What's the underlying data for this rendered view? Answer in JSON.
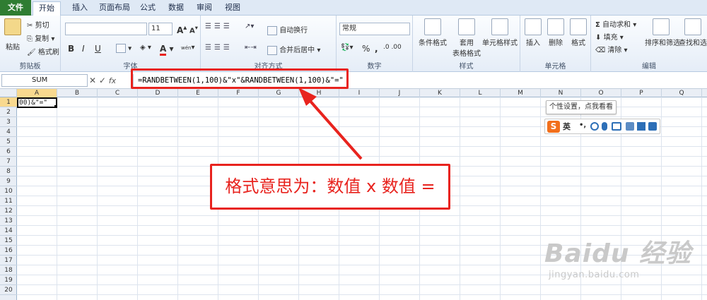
{
  "tabs": [
    {
      "label": "文件"
    },
    {
      "label": "开始"
    },
    {
      "label": "插入"
    },
    {
      "label": "页面布局"
    },
    {
      "label": "公式"
    },
    {
      "label": "数据"
    },
    {
      "label": "审阅"
    },
    {
      "label": "视图"
    }
  ],
  "ribbon": {
    "clipboard": {
      "paste": "粘贴",
      "cut": "剪切",
      "copy": "复制",
      "format_painter": "格式刷",
      "group": "剪贴板"
    },
    "font": {
      "size": "11",
      "bold": "B",
      "italic": "I",
      "underline": "U",
      "grow": "A",
      "shrink": "A",
      "color": "A",
      "wen": "wén",
      "group": "字体"
    },
    "alignment": {
      "wrap": "自动换行",
      "merge": "合并后居中",
      "group": "对齐方式"
    },
    "number": {
      "format": "常规",
      "percent": "%",
      "comma": ",",
      "group": "数字"
    },
    "styles": {
      "conditional": "条件格式",
      "table1": "套用",
      "table2": "表格格式",
      "cell_styles": "单元格样式",
      "group": "样式"
    },
    "cells": {
      "insert": "插入",
      "delete": "删除",
      "format": "格式",
      "group": "单元格"
    },
    "editing": {
      "autosum": "自动求和",
      "fill": "填充",
      "clear": "清除",
      "sort": "排序和筛选",
      "find": "查找和选择",
      "group": "编辑"
    }
  },
  "formula_bar": {
    "name_box": "SUM",
    "fx": "fx",
    "formula": "=RANDBETWEEN(1,100)&\"x\"&RANDBETWEEN(1,100)&\"=\""
  },
  "columns": [
    "A",
    "B",
    "C",
    "D",
    "E",
    "F",
    "G",
    "H",
    "I",
    "J",
    "K",
    "L",
    "M",
    "N",
    "O",
    "P",
    "Q"
  ],
  "rows": [
    "1",
    "2",
    "3",
    "4",
    "5",
    "6",
    "7",
    "8",
    "9",
    "10",
    "11",
    "12",
    "13",
    "14",
    "15",
    "16",
    "17",
    "18",
    "19",
    "20"
  ],
  "cell_a1": "00)&\"=\"",
  "annotation": {
    "text": "格式意思为：数值 x 数值 ="
  },
  "ime": {
    "tooltip": "个性设置，点我看看",
    "logo": "S",
    "mode": "英"
  },
  "watermark": {
    "logo": "Baidu 经验",
    "url": "jingyan.baidu.com"
  },
  "colors": {
    "highlight": "#e8231e",
    "file_tab": "#2f7d32",
    "ime": "#f26f1c"
  }
}
